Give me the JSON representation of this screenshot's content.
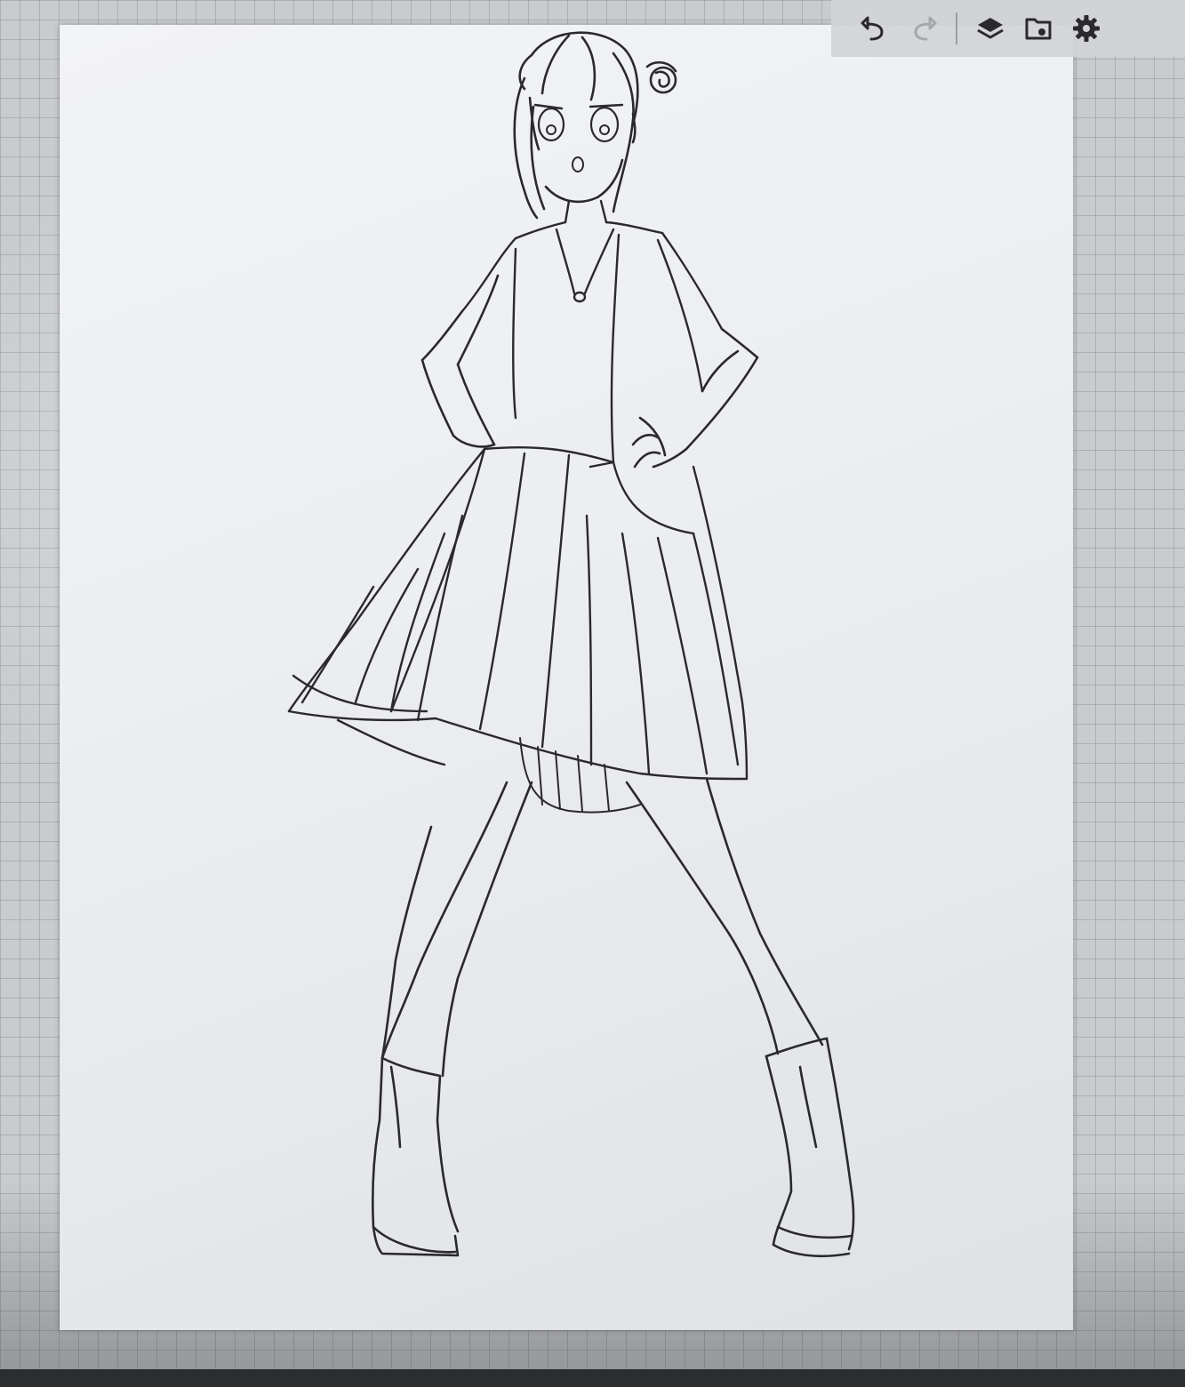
{
  "app": {
    "toolbar": {
      "undo": {
        "icon": "undo-icon",
        "enabled": true
      },
      "redo": {
        "icon": "redo-icon",
        "enabled": false
      },
      "layers": {
        "icon": "layers-icon"
      },
      "gallery": {
        "icon": "folder-export-icon"
      },
      "settings": {
        "icon": "gear-icon"
      }
    },
    "canvas": {
      "artwork": "pencil-sketch-figure",
      "background_color": "#eceef0",
      "stroke_color": "#2a2a2d"
    },
    "workspace": {
      "grid_color": "#a8abb0"
    }
  }
}
